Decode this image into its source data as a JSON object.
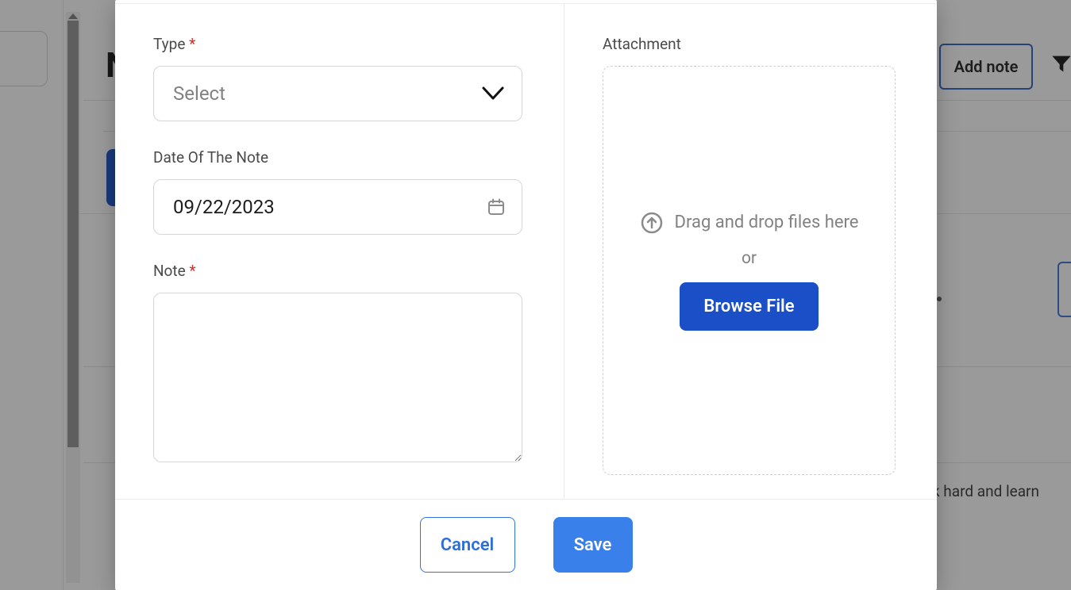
{
  "background": {
    "heading_fragment": "N",
    "add_note_label": "Add note",
    "text_snippet": "k hard and learn"
  },
  "modal": {
    "left": {
      "type": {
        "label": "Type",
        "required": "*",
        "placeholder": "Select"
      },
      "date": {
        "label": "Date Of The Note",
        "value": "09/22/2023"
      },
      "note": {
        "label": "Note",
        "required": "*",
        "value": ""
      }
    },
    "right": {
      "attachment_label": "Attachment",
      "drop_text": "Drag and drop files here",
      "or_text": "or",
      "browse_label": "Browse File"
    },
    "footer": {
      "cancel": "Cancel",
      "save": "Save"
    }
  }
}
